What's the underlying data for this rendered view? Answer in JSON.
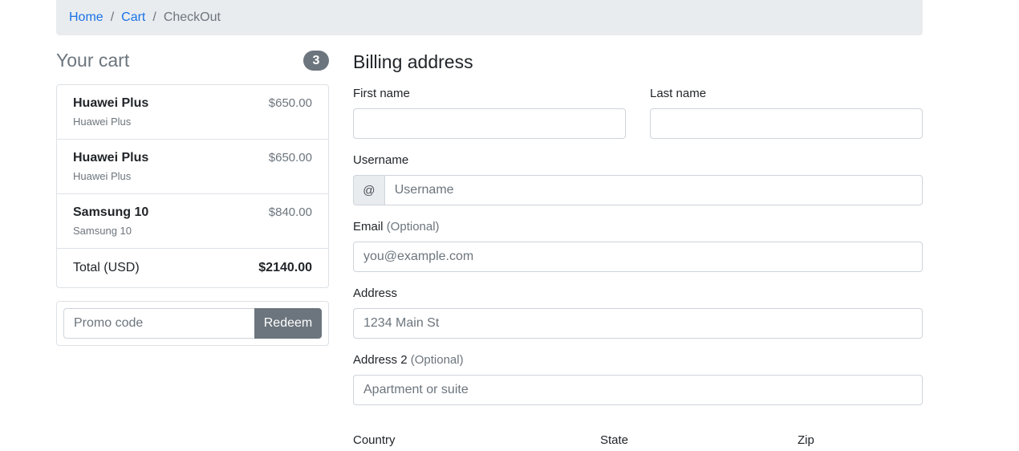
{
  "breadcrumb": {
    "home": "Home",
    "cart": "Cart",
    "current": "CheckOut",
    "separator": "/"
  },
  "cart": {
    "title": "Your cart",
    "count": "3",
    "items": [
      {
        "name": "Huawei Plus",
        "desc": "Huawei Plus",
        "price": "$650.00"
      },
      {
        "name": "Huawei Plus",
        "desc": "Huawei Plus",
        "price": "$650.00"
      },
      {
        "name": "Samsung 10",
        "desc": "Samsung 10",
        "price": "$840.00"
      }
    ],
    "total_label": "Total (USD)",
    "total_amount": "$2140.00"
  },
  "promo": {
    "placeholder": "Promo code",
    "button": "Redeem"
  },
  "billing": {
    "title": "Billing address",
    "first_name_label": "First name",
    "last_name_label": "Last name",
    "username_label": "Username",
    "username_addon": "@",
    "username_placeholder": "Username",
    "email_label": "Email",
    "email_optional": "(Optional)",
    "email_placeholder": "you@example.com",
    "address_label": "Address",
    "address_placeholder": "1234 Main St",
    "address2_label": "Address 2",
    "address2_optional": "(Optional)",
    "address2_placeholder": "Apartment or suite",
    "country_label": "Country",
    "state_label": "State",
    "zip_label": "Zip"
  },
  "colors": {
    "link": "#1a73e8",
    "muted": "#6c757d",
    "secondary_button": "#6c757d",
    "breadcrumb_bg": "#e9ecef"
  }
}
